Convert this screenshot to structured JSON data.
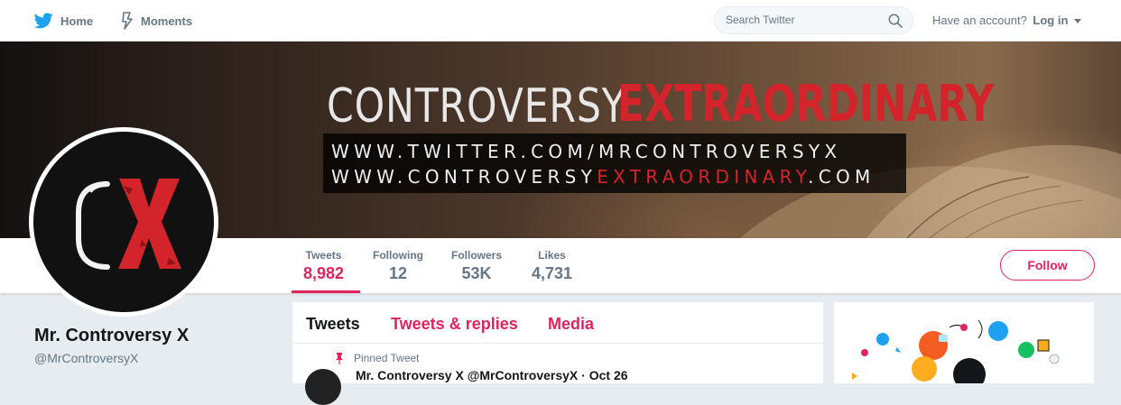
{
  "topbar": {
    "home_label": "Home",
    "moments_label": "Moments",
    "search_placeholder": "Search Twitter",
    "account_prompt": "Have an account?",
    "login_label": "Log in"
  },
  "banner": {
    "title_white": "CONTROVERSY",
    "title_red": "EXTRAORDINARY",
    "url1": "WWW.TWITTER.COM/MRCONTROVERSYX",
    "url2_prefix": "WWW.CONTROVERSY",
    "url2_red": "EXTRAORDINARY",
    "url2_suffix": ".COM"
  },
  "avatar": {
    "letter_left": "C",
    "letter_right": "X"
  },
  "stats": [
    {
      "label": "Tweets",
      "value": "8,982"
    },
    {
      "label": "Following",
      "value": "12"
    },
    {
      "label": "Followers",
      "value": "53K"
    },
    {
      "label": "Likes",
      "value": "4,731"
    }
  ],
  "follow_label": "Follow",
  "profile": {
    "name": "Mr. Controversy X",
    "handle": "@MrControversyX"
  },
  "timeline": {
    "tabs": [
      "Tweets",
      "Tweets & replies",
      "Media"
    ],
    "pinned_label": "Pinned Tweet",
    "tweet_preview": "Mr. Controversy X @MrControversyX · Oct 26"
  },
  "colors": {
    "accent": "#e0245e",
    "twitter_blue": "#1da1f2",
    "banner_red": "#d3242c"
  }
}
